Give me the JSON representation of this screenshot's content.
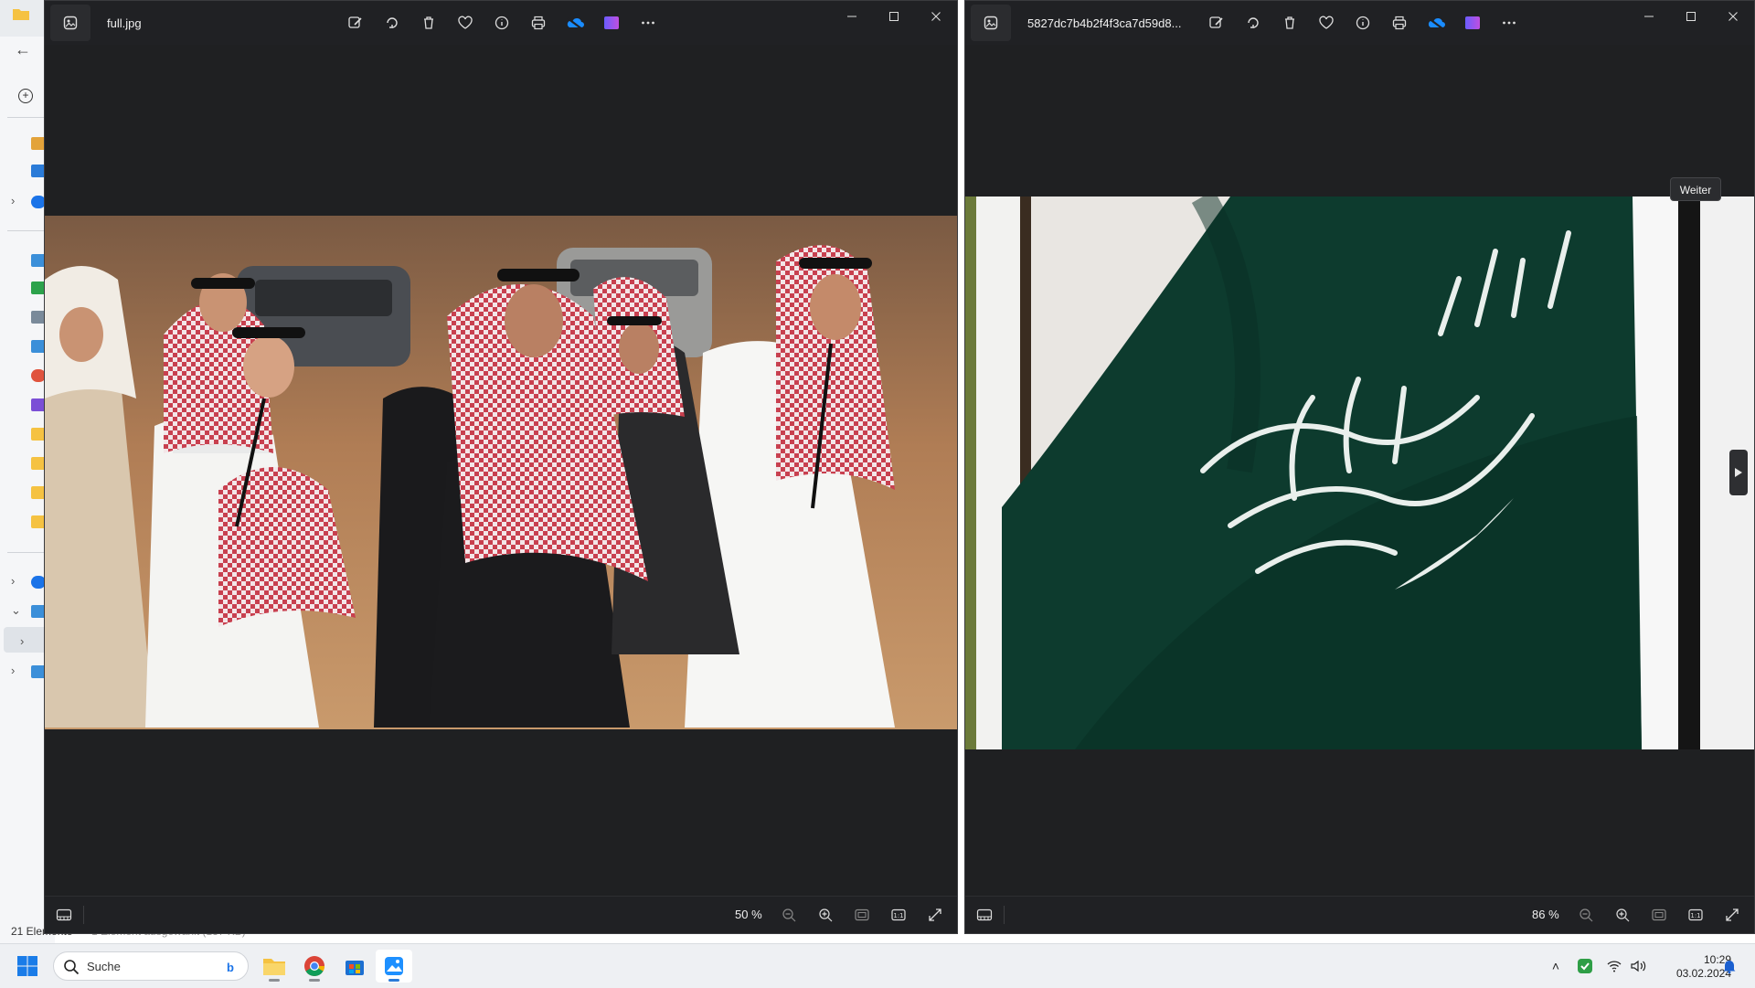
{
  "explorer": {
    "status_count": "21 Elemente",
    "status_selected": "1 Element ausgewählt (137 KB)"
  },
  "viewer_left": {
    "file_name": "full.jpg",
    "zoom": "50 %"
  },
  "viewer_right": {
    "file_name": "5827dc7b4b2f4f3ca7d59d8...",
    "zoom": "86 %",
    "tooltip": "Weiter"
  },
  "taskbar": {
    "search_placeholder": "Suche",
    "time": "10:29",
    "date": "03.02.2024"
  },
  "colors": {
    "viewer_bg": "#1f2022",
    "flag_green": "#0d3b2e",
    "taskbar_bg": "#eef0f3",
    "accent": "#2a7bd8"
  },
  "icons": [
    "edit-icon",
    "rotate-icon",
    "delete-icon",
    "favorite-icon",
    "info-icon",
    "print-icon",
    "onedrive-icon",
    "clipchamp-icon",
    "more-icon",
    "minimize-icon",
    "maximize-icon",
    "close-icon",
    "filmstrip-icon",
    "zoom-out-icon",
    "zoom-in-icon",
    "fit-icon",
    "actual-size-icon",
    "fullscreen-icon"
  ]
}
